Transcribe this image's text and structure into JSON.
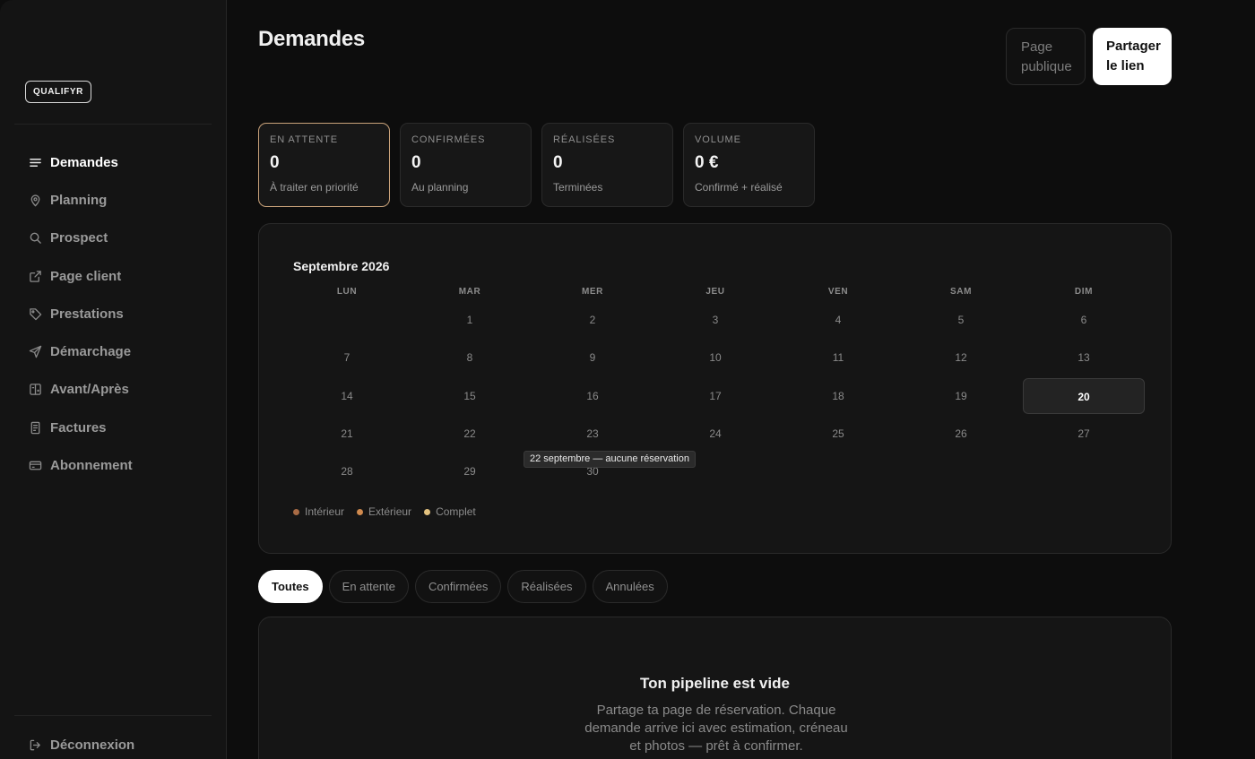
{
  "brand": {
    "logo": "QUALIFYR"
  },
  "sidebar": {
    "items": [
      {
        "label": "Demandes",
        "icon": "list-icon"
      },
      {
        "label": "Planning",
        "icon": "map-pin-icon"
      },
      {
        "label": "Prospect",
        "icon": "search-icon"
      },
      {
        "label": "Page client",
        "icon": "external-link-icon"
      },
      {
        "label": "Prestations",
        "icon": "tag-icon"
      },
      {
        "label": "Démarchage",
        "icon": "send-icon"
      },
      {
        "label": "Avant/Après",
        "icon": "before-after-icon"
      },
      {
        "label": "Factures",
        "icon": "receipt-icon"
      },
      {
        "label": "Abonnement",
        "icon": "credit-card-icon"
      }
    ],
    "logout": "Déconnexion"
  },
  "header": {
    "title": "Demandes",
    "public_page": [
      "Page",
      "publique"
    ],
    "share": [
      "Partager",
      "le lien"
    ]
  },
  "stats": [
    {
      "label": "EN ATTENTE",
      "value": "0",
      "sub": "À traiter en priorité",
      "highlight": true
    },
    {
      "label": "CONFIRMÉES",
      "value": "0",
      "sub": "Au planning",
      "highlight": false
    },
    {
      "label": "RÉALISÉES",
      "value": "0",
      "sub": "Terminées",
      "highlight": false
    },
    {
      "label": "VOLUME",
      "value": "0 €",
      "sub": "Confirmé + réalisé",
      "highlight": false
    }
  ],
  "calendar": {
    "title": "Septembre 2026",
    "weekdays": [
      "LUN",
      "MAR",
      "MER",
      "JEU",
      "VEN",
      "SAM",
      "DIM"
    ],
    "first_weekday_index": 1,
    "days_in_month": 30,
    "today": 20,
    "tooltip": "22 septembre — aucune réservation",
    "legend": [
      {
        "label": "Intérieur",
        "color": "#a86b45"
      },
      {
        "label": "Extérieur",
        "color": "#d08a4e"
      },
      {
        "label": "Complet",
        "color": "#e3c27f"
      }
    ]
  },
  "filters": [
    {
      "label": "Toutes",
      "active": true
    },
    {
      "label": "En attente",
      "active": false
    },
    {
      "label": "Confirmées",
      "active": false
    },
    {
      "label": "Réalisées",
      "active": false
    },
    {
      "label": "Annulées",
      "active": false
    }
  ],
  "empty": {
    "title": "Ton pipeline est vide",
    "text": "Partage ta page de réservation. Chaque demande arrive ici avec estimation, créneau et photos — prêt à confirmer."
  }
}
